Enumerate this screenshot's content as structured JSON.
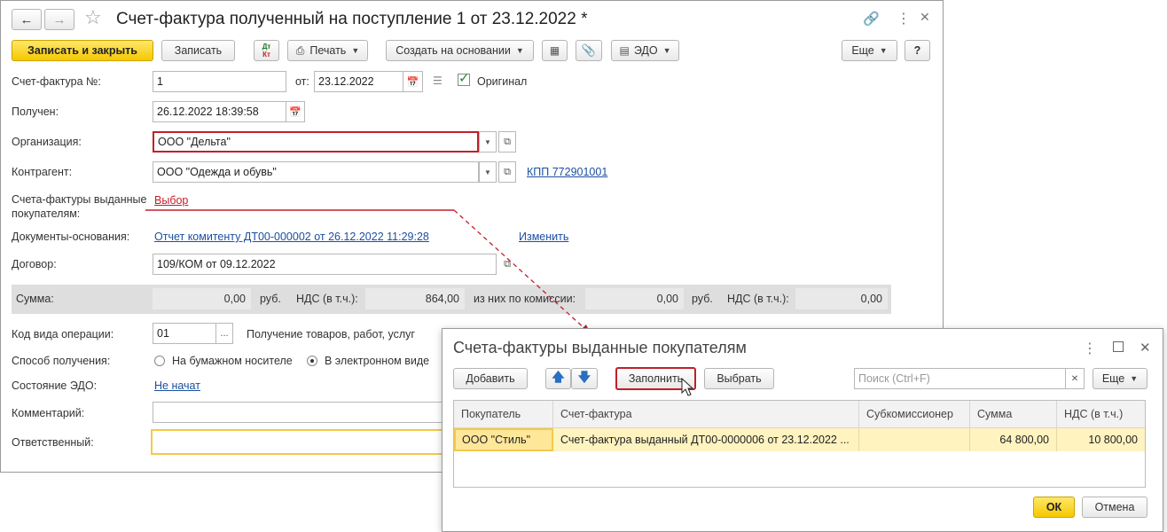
{
  "main": {
    "title": "Счет-фактура полученный на поступление 1 от 23.12.2022 *",
    "toolbar": {
      "save_close": "Записать и закрыть",
      "save": "Записать",
      "dtkt_top": "Дт",
      "dtkt_bottom": "Кт",
      "print": "Печать",
      "create_based": "Создать на основании",
      "edo": "ЭДО",
      "more": "Еще",
      "help": "?"
    },
    "fields": {
      "invoice_no_label": "Счет-фактура №:",
      "invoice_no": "1",
      "from_label": "от:",
      "from_date": "23.12.2022",
      "original_label": "Оригинал",
      "received_label": "Получен:",
      "received": "26.12.2022 18:39:58",
      "org_label": "Организация:",
      "org": "ООО \"Дельта\"",
      "counterparty_label": "Контрагент:",
      "counterparty": "ООО \"Одежда и обувь\"",
      "kpp_link": "КПП 772901001",
      "issued_label_1": "Счета-фактуры выданные",
      "issued_label_2": "покупателям:",
      "issued_link": "Выбор",
      "base_docs_label": "Документы-основания:",
      "base_docs_link": "Отчет комитенту ДТ00-000002 от 26.12.2022 11:29:28",
      "change_link": "Изменить",
      "contract_label": "Договор:",
      "contract": "109/КОМ от 09.12.2022",
      "op_code_label": "Код вида операции:",
      "op_code": "01",
      "op_code_dots": "...",
      "op_code_desc": "Получение товаров, работ, услуг",
      "method_label": "Способ получения:",
      "method_paper": "На бумажном носителе",
      "method_electronic": "В электронном виде",
      "edo_state_label": "Состояние ЭДО:",
      "edo_state_link": "Не начат",
      "comment_label": "Комментарий:",
      "responsible_label": "Ответственный:"
    },
    "sum": {
      "sum_label": "Сумма:",
      "sum": "0,00",
      "rub1": "руб.",
      "vat_label": "НДС (в т.ч.):",
      "vat": "864,00",
      "commission_label": "из них по комиссии:",
      "commission": "0,00",
      "rub2": "руб.",
      "vat2_label": "НДС (в т.ч.):",
      "vat2": "0,00"
    }
  },
  "dialog": {
    "title": "Счета-фактуры выданные покупателям",
    "add": "Добавить",
    "fill": "Заполнить",
    "select": "Выбрать",
    "search_placeholder": "Поиск (Ctrl+F)",
    "more": "Еще",
    "columns": [
      "Покупатель",
      "Счет-фактура",
      "Субкомиссионер",
      "Сумма",
      "НДС (в т.ч.)"
    ],
    "rows": [
      {
        "buyer": "ООО \"Стиль\"",
        "invoice": "Счет-фактура выданный ДТ00-0000006 от 23.12.2022 ...",
        "subcommissioner": "",
        "sum": "64 800,00",
        "vat": "10 800,00"
      }
    ],
    "ok": "ОК",
    "cancel": "Отмена"
  },
  "colors": {
    "accent_red": "#c0202a",
    "selection_yellow": "#fff3c0",
    "link_blue": "#1c4fa0",
    "button_yellow": "#f5c800"
  }
}
